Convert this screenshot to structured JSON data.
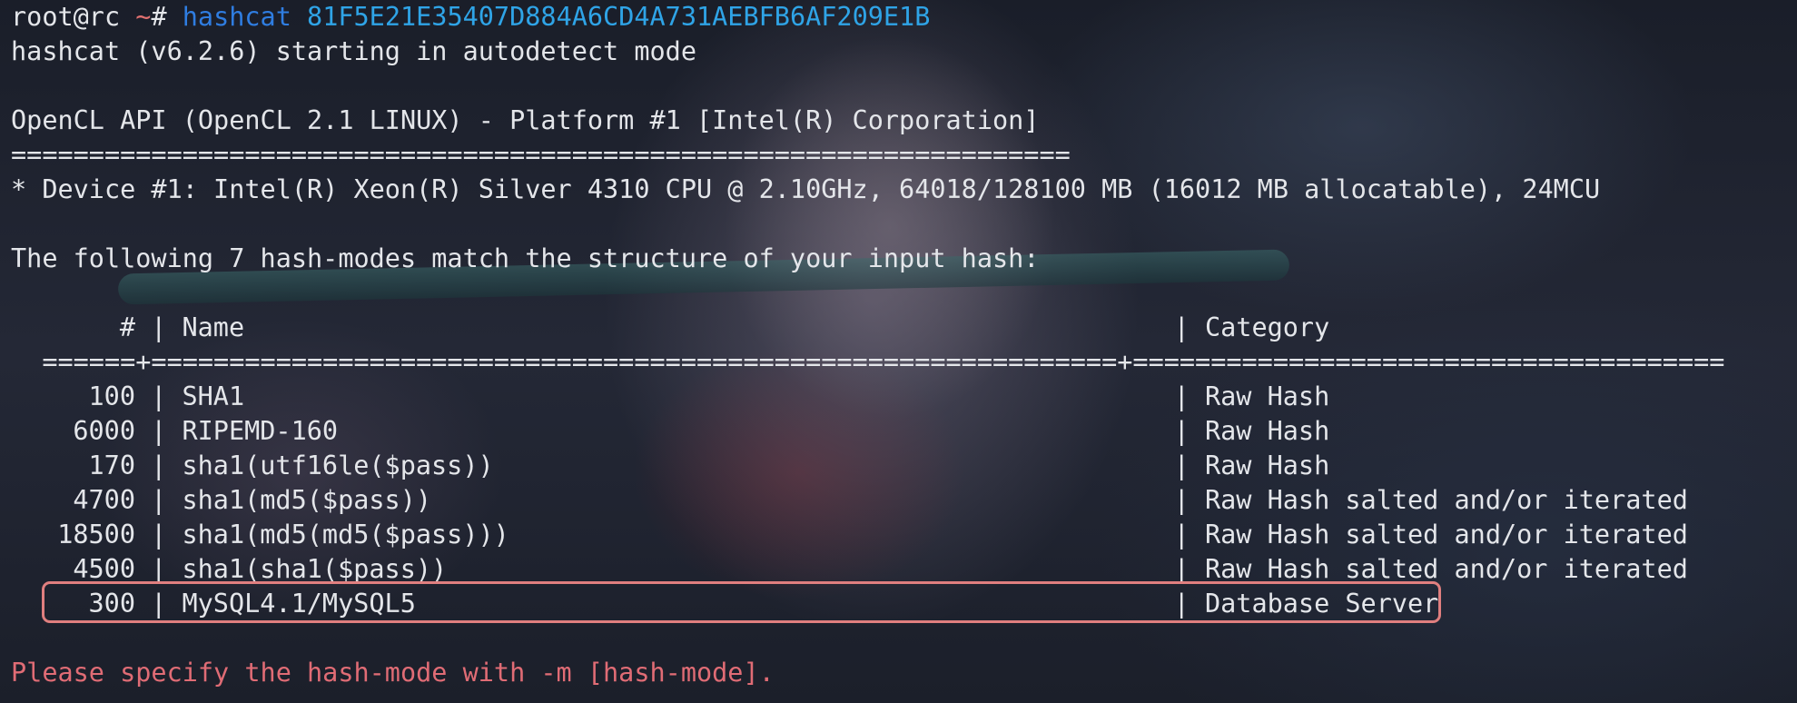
{
  "prompt": {
    "user_host": "root@rc",
    "tilde": " ~",
    "hash_symbol": "# ",
    "command": "hashcat",
    "argument": " 81F5E21E35407D884A6CD4A731AEBFB6AF209E1B"
  },
  "output": {
    "start_line": "hashcat (v6.2.6) starting in autodetect mode",
    "platform_line": "OpenCL API (OpenCL 2.1 LINUX) - Platform #1 [Intel(R) Corporation]",
    "platform_rule": "====================================================================",
    "device_line": "* Device #1: Intel(R) Xeon(R) Silver 4310 CPU @ 2.10GHz, 64018/128100 MB (16012 MB allocatable), 24MCU",
    "match_line": "The following 7 hash-modes match the structure of your input hash:",
    "error_line": "Please specify the hash-mode with -m [hash-mode]."
  },
  "table": {
    "header_num": "#",
    "header_name": "Name",
    "header_category": "Category",
    "rule": "  ======+==============================================================+======================================",
    "rows": [
      {
        "num": "100",
        "name": "SHA1",
        "category": "Raw Hash"
      },
      {
        "num": "6000",
        "name": "RIPEMD-160",
        "category": "Raw Hash"
      },
      {
        "num": "170",
        "name": "sha1(utf16le($pass))",
        "category": "Raw Hash"
      },
      {
        "num": "4700",
        "name": "sha1(md5($pass))",
        "category": "Raw Hash salted and/or iterated"
      },
      {
        "num": "18500",
        "name": "sha1(md5(md5($pass)))",
        "category": "Raw Hash salted and/or iterated"
      },
      {
        "num": "4500",
        "name": "sha1(sha1($pass))",
        "category": "Raw Hash salted and/or iterated"
      },
      {
        "num": "300",
        "name": "MySQL4.1/MySQL5",
        "category": "Database Server"
      }
    ],
    "separator": " | "
  },
  "colors": {
    "text": "#e4e6ea",
    "command": "#2f7de1",
    "argument": "#2fa4e7",
    "error": "#e06c75",
    "highlight_border": "#e07f7f"
  }
}
